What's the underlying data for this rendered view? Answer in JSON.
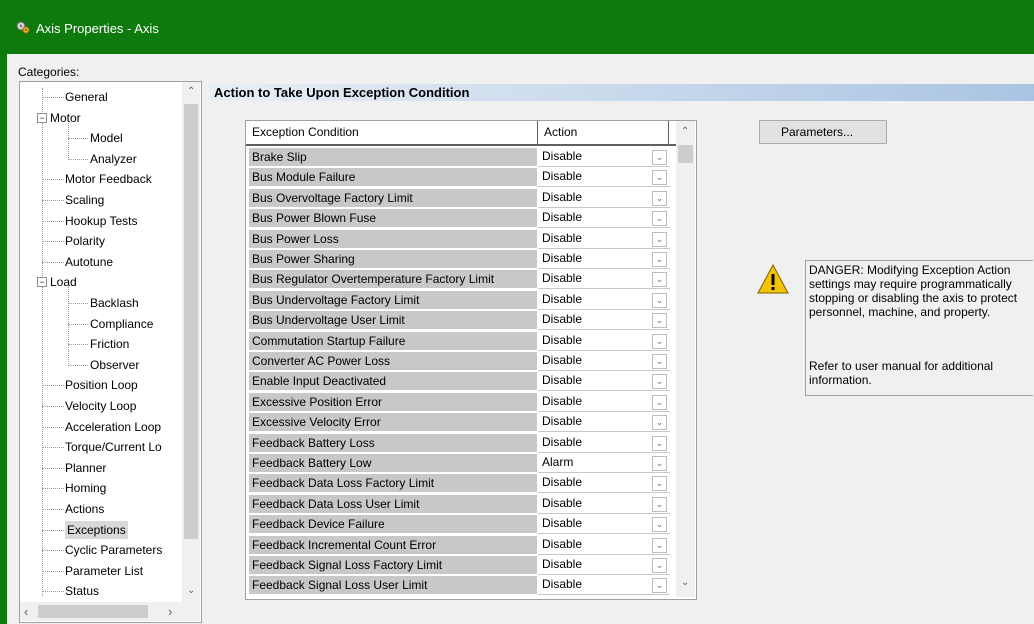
{
  "window": {
    "title": "Axis Properties - Axis",
    "accent_color": "#0e7a0e"
  },
  "categories_label": "Categories:",
  "tree": {
    "items": [
      {
        "label": "General",
        "level": 0
      },
      {
        "label": "Motor",
        "level": 0,
        "expanded": true
      },
      {
        "label": "Model",
        "level": 1
      },
      {
        "label": "Analyzer",
        "level": 1
      },
      {
        "label": "Motor Feedback",
        "level": 0
      },
      {
        "label": "Scaling",
        "level": 0
      },
      {
        "label": "Hookup Tests",
        "level": 0
      },
      {
        "label": "Polarity",
        "level": 0
      },
      {
        "label": "Autotune",
        "level": 0
      },
      {
        "label": "Load",
        "level": 0,
        "expanded": true
      },
      {
        "label": "Backlash",
        "level": 1
      },
      {
        "label": "Compliance",
        "level": 1
      },
      {
        "label": "Friction",
        "level": 1
      },
      {
        "label": "Observer",
        "level": 1
      },
      {
        "label": "Position Loop",
        "level": 0
      },
      {
        "label": "Velocity Loop",
        "level": 0
      },
      {
        "label": "Acceleration Loop",
        "level": 0
      },
      {
        "label": "Torque/Current Lo",
        "level": 0
      },
      {
        "label": "Planner",
        "level": 0
      },
      {
        "label": "Homing",
        "level": 0
      },
      {
        "label": "Actions",
        "level": 0
      },
      {
        "label": "Exceptions",
        "level": 0,
        "selected": true
      },
      {
        "label": "Cyclic Parameters",
        "level": 0
      },
      {
        "label": "Parameter List",
        "level": 0
      },
      {
        "label": "Status",
        "level": 0
      }
    ]
  },
  "section_title": "Action to Take Upon Exception Condition",
  "grid": {
    "columns": [
      "Exception Condition",
      "Action"
    ],
    "rows": [
      {
        "condition": "Brake Slip",
        "action": "Disable"
      },
      {
        "condition": "Bus Module Failure",
        "action": "Disable"
      },
      {
        "condition": "Bus Overvoltage Factory Limit",
        "action": "Disable"
      },
      {
        "condition": "Bus Power Blown Fuse",
        "action": "Disable"
      },
      {
        "condition": "Bus Power Loss",
        "action": "Disable"
      },
      {
        "condition": "Bus Power Sharing",
        "action": "Disable"
      },
      {
        "condition": "Bus Regulator Overtemperature Factory Limit",
        "action": "Disable"
      },
      {
        "condition": "Bus Undervoltage Factory Limit",
        "action": "Disable"
      },
      {
        "condition": "Bus Undervoltage User Limit",
        "action": "Disable"
      },
      {
        "condition": "Commutation Startup Failure",
        "action": "Disable"
      },
      {
        "condition": "Converter AC Power Loss",
        "action": "Disable"
      },
      {
        "condition": "Enable Input Deactivated",
        "action": "Disable"
      },
      {
        "condition": "Excessive Position Error",
        "action": "Disable"
      },
      {
        "condition": "Excessive Velocity Error",
        "action": "Disable"
      },
      {
        "condition": "Feedback Battery Loss",
        "action": "Disable"
      },
      {
        "condition": "Feedback Battery Low",
        "action": "Alarm"
      },
      {
        "condition": "Feedback Data Loss Factory Limit",
        "action": "Disable"
      },
      {
        "condition": "Feedback Data Loss User Limit",
        "action": "Disable"
      },
      {
        "condition": "Feedback Device Failure",
        "action": "Disable"
      },
      {
        "condition": "Feedback Incremental Count Error",
        "action": "Disable"
      },
      {
        "condition": "Feedback Signal Loss Factory Limit",
        "action": "Disable"
      },
      {
        "condition": "Feedback Signal Loss User Limit",
        "action": "Disable"
      }
    ]
  },
  "parameters_button": "Parameters...",
  "warning": {
    "text": "DANGER: Modifying Exception Action settings may require programmatically stopping or disabling the axis to protect personnel, machine, and property.",
    "note": "Refer to user manual for additional information."
  }
}
